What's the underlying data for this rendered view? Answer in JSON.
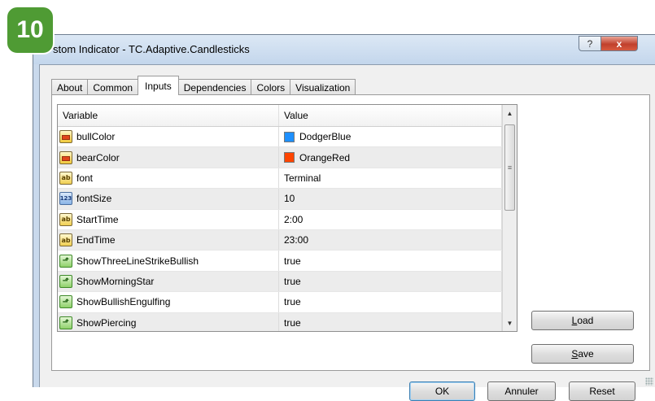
{
  "step_badge": "10",
  "window": {
    "title": "stom Indicator - TC.Adaptive.Candlesticks",
    "help_symbol": "?",
    "close_symbol": "x"
  },
  "tabs": [
    {
      "label": "About",
      "active": false
    },
    {
      "label": "Common",
      "active": false
    },
    {
      "label": "Inputs",
      "active": true
    },
    {
      "label": "Dependencies",
      "active": false
    },
    {
      "label": "Colors",
      "active": false
    },
    {
      "label": "Visualization",
      "active": false
    }
  ],
  "grid": {
    "headers": {
      "variable": "Variable",
      "value": "Value"
    },
    "rows": [
      {
        "variable": "bullColor",
        "value": "DodgerBlue",
        "type": "color",
        "swatch": "#1e90ff"
      },
      {
        "variable": "bearColor",
        "value": "OrangeRed",
        "type": "color",
        "swatch": "#ff4500"
      },
      {
        "variable": "font",
        "value": "Terminal",
        "type": "string"
      },
      {
        "variable": "fontSize",
        "value": "10",
        "type": "int"
      },
      {
        "variable": "StartTime",
        "value": "2:00",
        "type": "string"
      },
      {
        "variable": "EndTime",
        "value": "23:00",
        "type": "string"
      },
      {
        "variable": "ShowThreeLineStrikeBullish",
        "value": "true",
        "type": "bool"
      },
      {
        "variable": "ShowMorningStar",
        "value": "true",
        "type": "bool"
      },
      {
        "variable": "ShowBullishEngulfing",
        "value": "true",
        "type": "bool"
      },
      {
        "variable": "ShowPiercing",
        "value": "true",
        "type": "bool"
      }
    ]
  },
  "icons": {
    "string": "ab",
    "int": "123",
    "bool": "⬏"
  },
  "buttons": {
    "load_prefix": "",
    "load_mnemonic": "L",
    "load_rest": "oad",
    "save_prefix": "",
    "save_mnemonic": "S",
    "save_rest": "ave",
    "ok": "OK",
    "cancel": "Annuler",
    "reset": "Reset"
  },
  "colors": {
    "badge": "#4f9b34",
    "accent": "#3c7fb1"
  }
}
